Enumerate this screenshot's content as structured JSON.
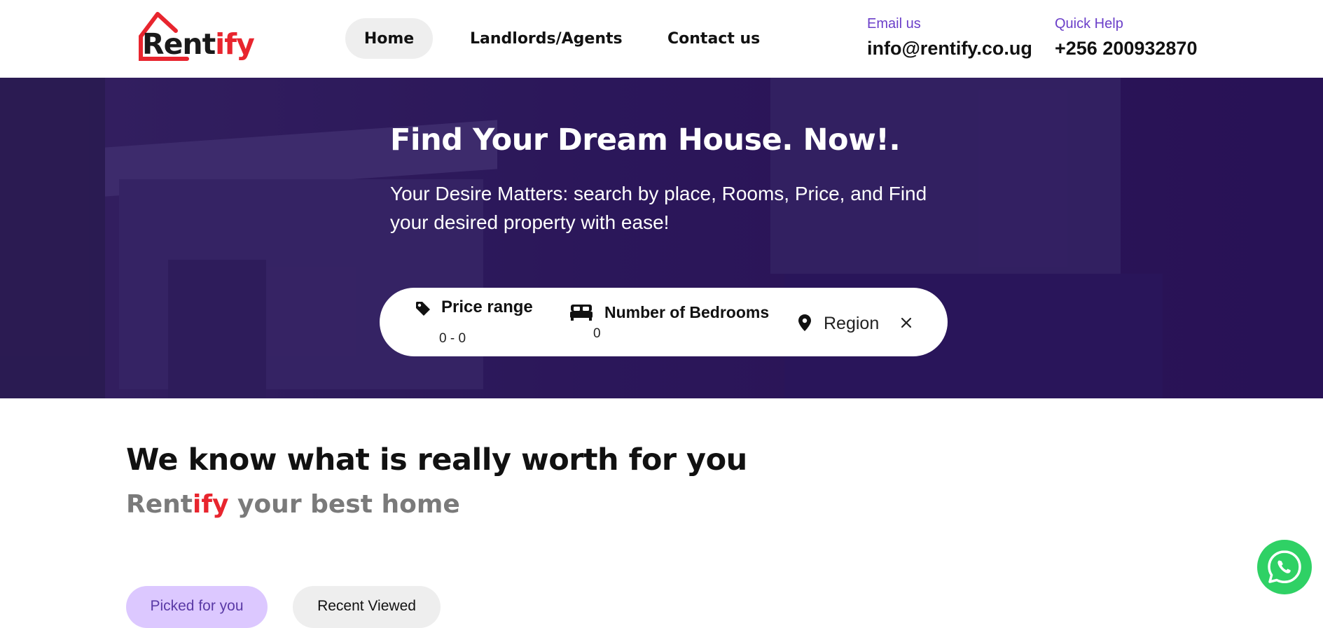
{
  "logo": {
    "part1": "Rent",
    "part2": "ify"
  },
  "nav": {
    "home": "Home",
    "landlords": "Landlords/Agents",
    "contact": "Contact us"
  },
  "contact": {
    "email_label": "Email us",
    "email_value": "info@rentify.co.ug",
    "help_label": "Quick Help",
    "help_value": "+256 200932870"
  },
  "hero": {
    "title": "Find Your Dream House. Now!.",
    "subtitle": "Your Desire Matters: search by place, Rooms, Price, and Find your desired property with ease!"
  },
  "search": {
    "price_label": "Price range",
    "price_value": "0 - 0",
    "bedrooms_label": "Number of Bedrooms",
    "bedrooms_value": "0",
    "region_label": "Region"
  },
  "section": {
    "title": "We know what is really worth for you",
    "tagline_part1": "Rent",
    "tagline_part2": "ify",
    "tagline_part3": " your best home"
  },
  "tabs": {
    "picked": "Picked for you",
    "recent": "Recent Viewed"
  },
  "icons": {
    "price": "tag-icon",
    "bedrooms": "bed-icon",
    "region": "location-pin-icon",
    "clear": "close-icon",
    "chat": "whatsapp-icon"
  },
  "colors": {
    "brand_red": "#e8252e",
    "accent_purple": "#6b3fc9",
    "hero_purple": "#2a1456",
    "active_tab_bg": "#dcc8ff",
    "whatsapp_green": "#2fd165"
  }
}
